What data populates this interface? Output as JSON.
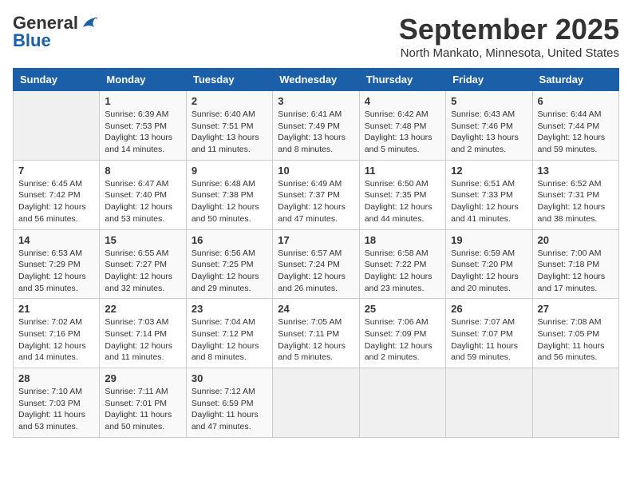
{
  "header": {
    "logo_general": "General",
    "logo_blue": "Blue",
    "month_year": "September 2025",
    "location": "North Mankato, Minnesota, United States"
  },
  "days_of_week": [
    "Sunday",
    "Monday",
    "Tuesday",
    "Wednesday",
    "Thursday",
    "Friday",
    "Saturday"
  ],
  "weeks": [
    [
      {
        "date": "",
        "info": ""
      },
      {
        "date": "1",
        "info": "Sunrise: 6:39 AM\nSunset: 7:53 PM\nDaylight: 13 hours\nand 14 minutes."
      },
      {
        "date": "2",
        "info": "Sunrise: 6:40 AM\nSunset: 7:51 PM\nDaylight: 13 hours\nand 11 minutes."
      },
      {
        "date": "3",
        "info": "Sunrise: 6:41 AM\nSunset: 7:49 PM\nDaylight: 13 hours\nand 8 minutes."
      },
      {
        "date": "4",
        "info": "Sunrise: 6:42 AM\nSunset: 7:48 PM\nDaylight: 13 hours\nand 5 minutes."
      },
      {
        "date": "5",
        "info": "Sunrise: 6:43 AM\nSunset: 7:46 PM\nDaylight: 13 hours\nand 2 minutes."
      },
      {
        "date": "6",
        "info": "Sunrise: 6:44 AM\nSunset: 7:44 PM\nDaylight: 12 hours\nand 59 minutes."
      }
    ],
    [
      {
        "date": "7",
        "info": "Sunrise: 6:45 AM\nSunset: 7:42 PM\nDaylight: 12 hours\nand 56 minutes."
      },
      {
        "date": "8",
        "info": "Sunrise: 6:47 AM\nSunset: 7:40 PM\nDaylight: 12 hours\nand 53 minutes."
      },
      {
        "date": "9",
        "info": "Sunrise: 6:48 AM\nSunset: 7:38 PM\nDaylight: 12 hours\nand 50 minutes."
      },
      {
        "date": "10",
        "info": "Sunrise: 6:49 AM\nSunset: 7:37 PM\nDaylight: 12 hours\nand 47 minutes."
      },
      {
        "date": "11",
        "info": "Sunrise: 6:50 AM\nSunset: 7:35 PM\nDaylight: 12 hours\nand 44 minutes."
      },
      {
        "date": "12",
        "info": "Sunrise: 6:51 AM\nSunset: 7:33 PM\nDaylight: 12 hours\nand 41 minutes."
      },
      {
        "date": "13",
        "info": "Sunrise: 6:52 AM\nSunset: 7:31 PM\nDaylight: 12 hours\nand 38 minutes."
      }
    ],
    [
      {
        "date": "14",
        "info": "Sunrise: 6:53 AM\nSunset: 7:29 PM\nDaylight: 12 hours\nand 35 minutes."
      },
      {
        "date": "15",
        "info": "Sunrise: 6:55 AM\nSunset: 7:27 PM\nDaylight: 12 hours\nand 32 minutes."
      },
      {
        "date": "16",
        "info": "Sunrise: 6:56 AM\nSunset: 7:25 PM\nDaylight: 12 hours\nand 29 minutes."
      },
      {
        "date": "17",
        "info": "Sunrise: 6:57 AM\nSunset: 7:24 PM\nDaylight: 12 hours\nand 26 minutes."
      },
      {
        "date": "18",
        "info": "Sunrise: 6:58 AM\nSunset: 7:22 PM\nDaylight: 12 hours\nand 23 minutes."
      },
      {
        "date": "19",
        "info": "Sunrise: 6:59 AM\nSunset: 7:20 PM\nDaylight: 12 hours\nand 20 minutes."
      },
      {
        "date": "20",
        "info": "Sunrise: 7:00 AM\nSunset: 7:18 PM\nDaylight: 12 hours\nand 17 minutes."
      }
    ],
    [
      {
        "date": "21",
        "info": "Sunrise: 7:02 AM\nSunset: 7:16 PM\nDaylight: 12 hours\nand 14 minutes."
      },
      {
        "date": "22",
        "info": "Sunrise: 7:03 AM\nSunset: 7:14 PM\nDaylight: 12 hours\nand 11 minutes."
      },
      {
        "date": "23",
        "info": "Sunrise: 7:04 AM\nSunset: 7:12 PM\nDaylight: 12 hours\nand 8 minutes."
      },
      {
        "date": "24",
        "info": "Sunrise: 7:05 AM\nSunset: 7:11 PM\nDaylight: 12 hours\nand 5 minutes."
      },
      {
        "date": "25",
        "info": "Sunrise: 7:06 AM\nSunset: 7:09 PM\nDaylight: 12 hours\nand 2 minutes."
      },
      {
        "date": "26",
        "info": "Sunrise: 7:07 AM\nSunset: 7:07 PM\nDaylight: 11 hours\nand 59 minutes."
      },
      {
        "date": "27",
        "info": "Sunrise: 7:08 AM\nSunset: 7:05 PM\nDaylight: 11 hours\nand 56 minutes."
      }
    ],
    [
      {
        "date": "28",
        "info": "Sunrise: 7:10 AM\nSunset: 7:03 PM\nDaylight: 11 hours\nand 53 minutes."
      },
      {
        "date": "29",
        "info": "Sunrise: 7:11 AM\nSunset: 7:01 PM\nDaylight: 11 hours\nand 50 minutes."
      },
      {
        "date": "30",
        "info": "Sunrise: 7:12 AM\nSunset: 6:59 PM\nDaylight: 11 hours\nand 47 minutes."
      },
      {
        "date": "",
        "info": ""
      },
      {
        "date": "",
        "info": ""
      },
      {
        "date": "",
        "info": ""
      },
      {
        "date": "",
        "info": ""
      }
    ]
  ]
}
